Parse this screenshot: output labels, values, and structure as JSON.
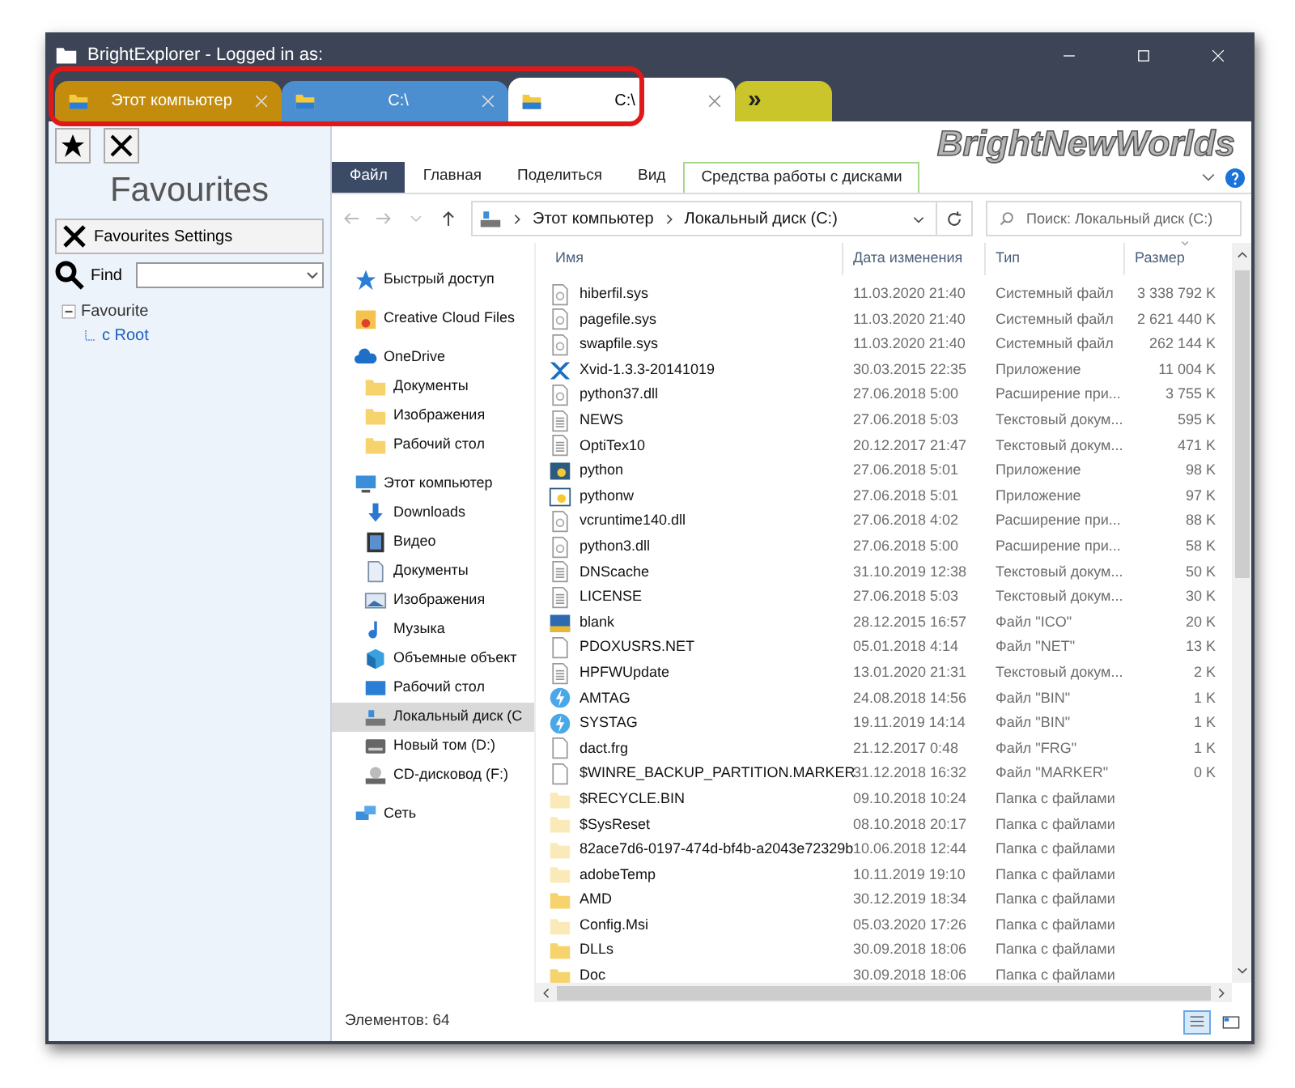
{
  "window": {
    "title": "BrightExplorer - Logged in as:"
  },
  "tabs": [
    {
      "label": "Этот компьютер",
      "selected": false,
      "color": "#c38c0c",
      "closable": true
    },
    {
      "label": "C:\\",
      "selected": false,
      "color": "#4c8fd0",
      "closable": true
    },
    {
      "label": "C:\\",
      "selected": true,
      "color": "#ffffff",
      "closable": true
    },
    {
      "label": "»",
      "selected": false,
      "color": "#c9c52a",
      "closable": false
    }
  ],
  "brand": "BrightNewWorlds",
  "favourites_panel": {
    "title": "Favourites",
    "settings_button": "Favourites Settings",
    "find_label": "Find",
    "tree": [
      {
        "label": "Favourite",
        "expanded": true,
        "children": [
          {
            "label": "c Root"
          }
        ]
      }
    ]
  },
  "ribbon_tabs": [
    {
      "label": "Файл",
      "kind": "file"
    },
    {
      "label": "Главная",
      "kind": "plain"
    },
    {
      "label": "Поделиться",
      "kind": "plain"
    },
    {
      "label": "Вид",
      "kind": "plain"
    },
    {
      "label": "Средства работы с дисками",
      "kind": "context"
    }
  ],
  "address_bar": {
    "crumbs": [
      "Этот компьютер",
      "Локальный диск (C:)"
    ],
    "search_placeholder": "Поиск: Локальный диск (C:)"
  },
  "nav_pane": [
    {
      "label": "Быстрый доступ",
      "kind": "star",
      "selected": false
    },
    {
      "label": "Creative Cloud Files",
      "kind": "ccfolder",
      "selected": false
    },
    {
      "label": "OneDrive",
      "kind": "cloud",
      "selected": false,
      "children": [
        {
          "label": "Документы",
          "kind": "folder",
          "selected": false
        },
        {
          "label": "Изображения",
          "kind": "folder",
          "selected": false
        },
        {
          "label": "Рабочий стол",
          "kind": "folder",
          "selected": false
        }
      ]
    },
    {
      "label": "Этот компьютер",
      "kind": "computer",
      "selected": false,
      "children": [
        {
          "label": "Downloads",
          "kind": "download",
          "selected": false
        },
        {
          "label": "Видео",
          "kind": "video",
          "selected": false
        },
        {
          "label": "Документы",
          "kind": "document",
          "selected": false
        },
        {
          "label": "Изображения",
          "kind": "image",
          "selected": false
        },
        {
          "label": "Музыка",
          "kind": "music",
          "selected": false
        },
        {
          "label": "Объемные объект",
          "kind": "cube",
          "selected": false
        },
        {
          "label": "Рабочий стол",
          "kind": "desktop",
          "selected": false
        },
        {
          "label": "Локальный диск (C",
          "kind": "drive",
          "selected": true
        },
        {
          "label": "Новый том (D:)",
          "kind": "hdd",
          "selected": false
        },
        {
          "label": "CD-дисковод (F:)",
          "kind": "cd",
          "selected": false
        }
      ]
    },
    {
      "label": "Сеть",
      "kind": "network",
      "selected": false
    }
  ],
  "file_list": {
    "columns": [
      "Имя",
      "Дата изменения",
      "Тип",
      "Размер"
    ],
    "rows": [
      {
        "kind": "sys",
        "name": "hiberfil.sys",
        "date": "11.03.2020 21:40",
        "type": "Системный файл",
        "size": "3 338 792 K"
      },
      {
        "kind": "sys",
        "name": "pagefile.sys",
        "date": "11.03.2020 21:40",
        "type": "Системный файл",
        "size": "2 621 440 K"
      },
      {
        "kind": "sys",
        "name": "swapfile.sys",
        "date": "11.03.2020 21:40",
        "type": "Системный файл",
        "size": "262 144 K"
      },
      {
        "kind": "xapp",
        "name": "Xvid-1.3.3-20141019",
        "date": "30.03.2015 22:35",
        "type": "Приложение",
        "size": "11 004 K"
      },
      {
        "kind": "sys",
        "name": "python37.dll",
        "date": "27.06.2018 5:00",
        "type": "Расширение при...",
        "size": "3 755 K"
      },
      {
        "kind": "text",
        "name": "NEWS",
        "date": "27.06.2018 5:03",
        "type": "Текстовый докум...",
        "size": "595 K"
      },
      {
        "kind": "text",
        "name": "OptiTex10",
        "date": "20.12.2017 21:47",
        "type": "Текстовый докум...",
        "size": "471 K"
      },
      {
        "kind": "python",
        "name": "python",
        "date": "27.06.2018 5:01",
        "type": "Приложение",
        "size": "98 K"
      },
      {
        "kind": "pythonw",
        "name": "pythonw",
        "date": "27.06.2018 5:01",
        "type": "Приложение",
        "size": "97 K"
      },
      {
        "kind": "sys",
        "name": "vcruntime140.dll",
        "date": "27.06.2018 4:02",
        "type": "Расширение при...",
        "size": "88 K"
      },
      {
        "kind": "sys",
        "name": "python3.dll",
        "date": "27.06.2018 5:00",
        "type": "Расширение при...",
        "size": "58 K"
      },
      {
        "kind": "text",
        "name": "DNScache",
        "date": "31.10.2019 12:38",
        "type": "Текстовый докум...",
        "size": "50 K"
      },
      {
        "kind": "text",
        "name": "LICENSE",
        "date": "27.06.2018 5:03",
        "type": "Текстовый докум...",
        "size": "30 K"
      },
      {
        "kind": "ico",
        "name": "blank",
        "date": "28.12.2015 16:57",
        "type": "Файл \"ICO\"",
        "size": "20 K"
      },
      {
        "kind": "blank",
        "name": "PDOXUSRS.NET",
        "date": "05.01.2018 4:14",
        "type": "Файл \"NET\"",
        "size": "13 K"
      },
      {
        "kind": "text",
        "name": "HPFWUpdate",
        "date": "13.01.2020 21:31",
        "type": "Текстовый докум...",
        "size": "2 K"
      },
      {
        "kind": "bin",
        "name": "AMTAG",
        "date": "24.08.2018 14:56",
        "type": "Файл \"BIN\"",
        "size": "1 K"
      },
      {
        "kind": "bin",
        "name": "SYSTAG",
        "date": "19.11.2019 14:14",
        "type": "Файл \"BIN\"",
        "size": "1 K"
      },
      {
        "kind": "blank",
        "name": "dact.frg",
        "date": "21.12.2017 0:48",
        "type": "Файл \"FRG\"",
        "size": "1 K"
      },
      {
        "kind": "blank",
        "name": "$WINRE_BACKUP_PARTITION.MARKER",
        "date": "31.12.2018 16:32",
        "type": "Файл \"MARKER\"",
        "size": "0 K"
      },
      {
        "kind": "hiddenfolder",
        "name": "$RECYCLE.BIN",
        "date": "09.10.2018 10:24",
        "type": "Папка с файлами"
      },
      {
        "kind": "hiddenfolder",
        "name": "$SysReset",
        "date": "08.10.2018 20:17",
        "type": "Папка с файлами"
      },
      {
        "kind": "hiddenfolder",
        "name": "82ace7d6-0197-474d-bf4b-a2043e72329b",
        "date": "10.06.2018 12:44",
        "type": "Папка с файлами"
      },
      {
        "kind": "hiddenfolder",
        "name": "adobeTemp",
        "date": "10.11.2019 19:10",
        "type": "Папка с файлами"
      },
      {
        "kind": "folder",
        "name": "AMD",
        "date": "30.12.2019 18:34",
        "type": "Папка с файлами"
      },
      {
        "kind": "hiddenfolder",
        "name": "Config.Msi",
        "date": "05.03.2020 17:26",
        "type": "Папка с файлами"
      },
      {
        "kind": "folder",
        "name": "DLLs",
        "date": "30.09.2018 18:06",
        "type": "Папка с файлами"
      },
      {
        "kind": "folder",
        "name": "Doc",
        "date": "30.09.2018 18:06",
        "type": "Папка с файлами"
      }
    ]
  },
  "status_bar": {
    "count": "Элементов: 64"
  }
}
